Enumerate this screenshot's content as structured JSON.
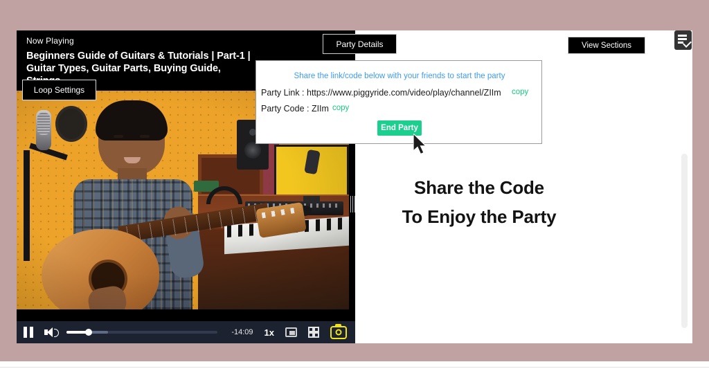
{
  "app": {
    "background_color": "#c0a2a2",
    "panel_color": "#ffffff"
  },
  "player": {
    "now_playing_label": "Now Playing",
    "video_title": "Beginners Guide of Guitars & Tutorials | Part-1 | Guitar Types, Guitar Parts, Buying Guide, Strings",
    "loop_settings_label": "Loop Settings",
    "drag_handle_icon": "resize-grip-icon",
    "controls": {
      "pause_icon": "pause-icon",
      "volume_icon": "volume-on-icon",
      "progress_percent": 15,
      "buffered_percent": 28,
      "time_remaining": "-14:09",
      "playback_speed": "1x",
      "pip_icon": "picture-in-picture-icon",
      "fullscreen_icon": "exit-fullscreen-icon",
      "screenshot_icon": "camera-icon",
      "screenshot_highlight_color": "#f2e313"
    }
  },
  "topbar": {
    "party_details_label": "Party Details",
    "view_sections_label": "View Sections",
    "sections_icon": "list-check-icon"
  },
  "popup": {
    "subtitle": "Share the link/code below with your friends to start the party",
    "subtitle_color": "#3d9bf0",
    "party_link_label": "Party Link : https://www.piggyride.com/video/play/channel/ZIIm",
    "party_link_copy_label": "copy",
    "party_code_label": "Party Code : ZIIm",
    "party_code_copy_label": "copy",
    "copy_link_color": "#17c97f",
    "end_party_label": "End Party",
    "end_party_color": "#1ccf8e"
  },
  "right_panel": {
    "headline_line1": "Share the Code",
    "headline_line2": "To Enjoy the Party"
  },
  "cursor": {
    "icon": "arrow-cursor-icon"
  }
}
